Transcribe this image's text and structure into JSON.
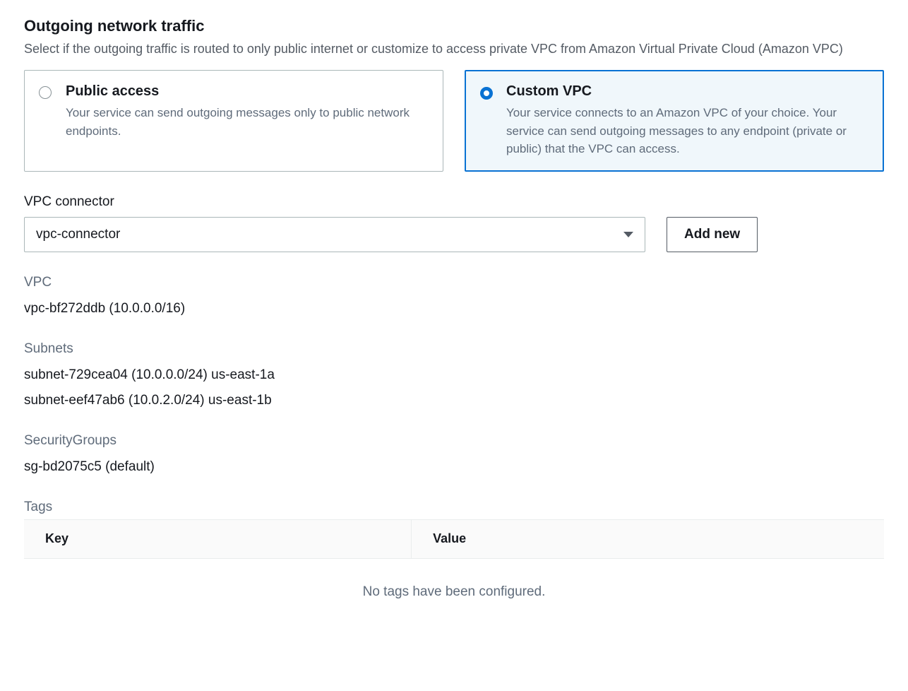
{
  "section": {
    "title": "Outgoing network traffic",
    "description": "Select if the outgoing traffic is routed to only public internet or customize to access private VPC from Amazon Virtual Private Cloud (Amazon VPC)"
  },
  "options": {
    "public": {
      "title": "Public access",
      "description": "Your service can send outgoing messages only to public network endpoints."
    },
    "custom": {
      "title": "Custom VPC",
      "description": "Your service connects to an Amazon VPC of your choice. Your service can send outgoing messages to any endpoint (private or public) that the VPC can access."
    }
  },
  "connector": {
    "label": "VPC connector",
    "selected": "vpc-connector",
    "add_new_label": "Add new"
  },
  "vpc": {
    "label": "VPC",
    "value": "vpc-bf272ddb (10.0.0.0/16)"
  },
  "subnets": {
    "label": "Subnets",
    "items": [
      "subnet-729cea04 (10.0.0.0/24) us-east-1a",
      "subnet-eef47ab6 (10.0.2.0/24) us-east-1b"
    ]
  },
  "security_groups": {
    "label": "SecurityGroups",
    "value": "sg-bd2075c5 (default)"
  },
  "tags": {
    "label": "Tags",
    "columns": {
      "key": "Key",
      "value": "Value"
    },
    "empty_message": "No tags have been configured."
  }
}
